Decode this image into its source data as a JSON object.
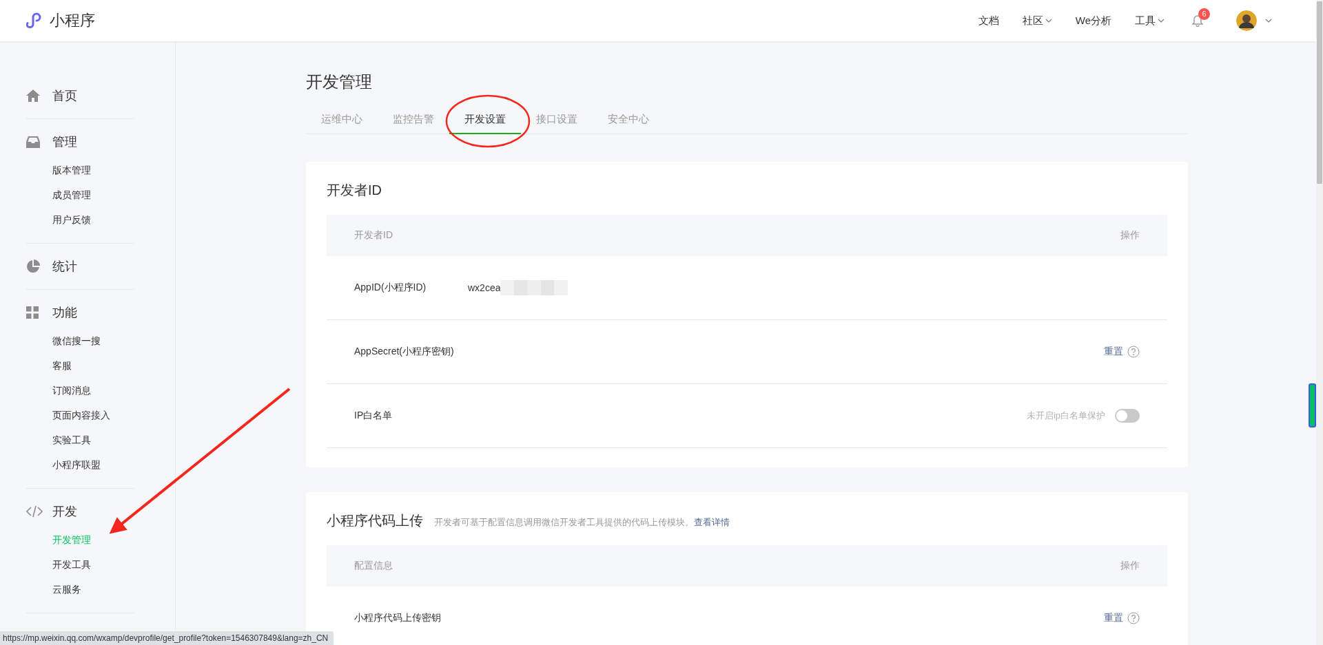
{
  "header": {
    "logo_text": "小程序",
    "nav": [
      {
        "label": "文档",
        "dropdown": false
      },
      {
        "label": "社区",
        "dropdown": true
      },
      {
        "label": "We分析",
        "dropdown": false
      },
      {
        "label": "工具",
        "dropdown": true
      }
    ],
    "notification_count": "6"
  },
  "sidebar": {
    "sections": [
      {
        "label": "首页",
        "kind": "home"
      },
      {
        "label": "管理",
        "kind": "inbox",
        "items": [
          {
            "label": "版本管理",
            "selected": false
          },
          {
            "label": "成员管理",
            "selected": false
          },
          {
            "label": "用户反馈",
            "selected": false
          }
        ]
      },
      {
        "label": "统计",
        "kind": "pie"
      },
      {
        "label": "功能",
        "kind": "grid",
        "items": [
          {
            "label": "微信搜一搜",
            "selected": false
          },
          {
            "label": "客服",
            "selected": false
          },
          {
            "label": "订阅消息",
            "selected": false
          },
          {
            "label": "页面内容接入",
            "selected": false
          },
          {
            "label": "实验工具",
            "selected": false
          },
          {
            "label": "小程序联盟",
            "selected": false
          }
        ]
      },
      {
        "label": "开发",
        "kind": "code",
        "items": [
          {
            "label": "开发管理",
            "selected": true
          },
          {
            "label": "开发工具",
            "selected": false
          },
          {
            "label": "云服务",
            "selected": false
          }
        ]
      }
    ]
  },
  "page_title": "开发管理",
  "tabs": [
    {
      "label": "运维中心",
      "selected": false
    },
    {
      "label": "监控告警",
      "selected": false
    },
    {
      "label": "开发设置",
      "selected": true
    },
    {
      "label": "接口设置",
      "selected": false
    },
    {
      "label": "安全中心",
      "selected": false
    }
  ],
  "cards": [
    {
      "title": "开发者ID",
      "columns": [
        "开发者ID",
        "操作"
      ],
      "rows": [
        {
          "kind": "value",
          "label": "AppID(小程序ID)",
          "value": "wx2cea"
        },
        {
          "kind": "action",
          "label": "AppSecret(小程序密钥)",
          "action": "重置"
        },
        {
          "kind": "toggle",
          "label": "IP白名单",
          "status": "未开启ip白名单保护",
          "on": false
        }
      ]
    },
    {
      "title": "小程序代码上传",
      "description": "开发者可基于配置信息调用微信开发者工具提供的代码上传模块。",
      "link": "查看详情",
      "columns": [
        "配置信息",
        "操作"
      ],
      "rows": [
        {
          "kind": "action",
          "label": "小程序代码上传密钥",
          "action": "重置"
        }
      ]
    }
  ],
  "status_bar": {
    "url": "https://mp.weixin.qq.com/wxamp/devprofile/get_profile?token=1546307849&lang=zh_CN"
  }
}
